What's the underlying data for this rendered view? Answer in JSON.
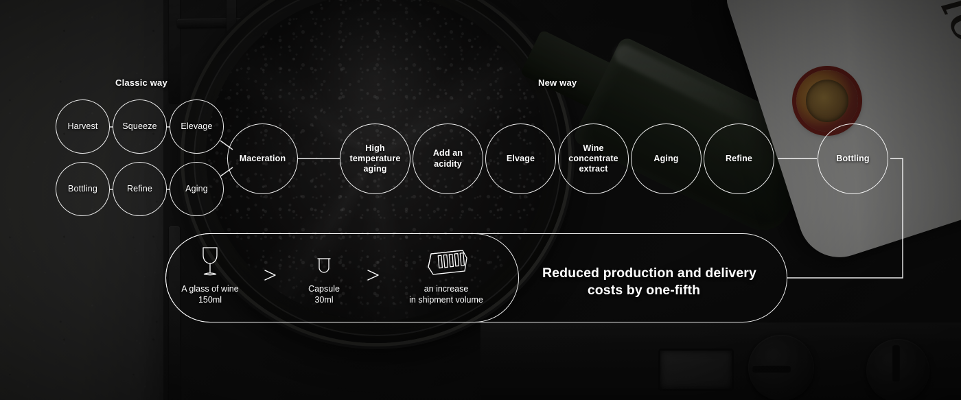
{
  "sections": {
    "classic_label": "Classic way",
    "new_label": "New way"
  },
  "classic_way": {
    "row_top": [
      {
        "label": "Harvest"
      },
      {
        "label": "Squeeze"
      },
      {
        "label": "Elevage"
      }
    ],
    "row_bottom": [
      {
        "label": "Bottling"
      },
      {
        "label": "Refine"
      },
      {
        "label": "Aging"
      }
    ]
  },
  "hub": {
    "label": "Maceration"
  },
  "new_way": [
    {
      "label": "High\ntemperature\naging"
    },
    {
      "label": "Add an\nacidity"
    },
    {
      "label": "Elvage"
    },
    {
      "label": "Wine\nconcentrate\nextract"
    },
    {
      "label": "Aging"
    },
    {
      "label": "Refine"
    },
    {
      "label": "Bottling"
    }
  ],
  "metrics_panel": {
    "items": [
      {
        "icon": "wine-glass-icon",
        "line1": "A glass of wine",
        "line2": "150ml"
      },
      {
        "icon": "capsule-icon",
        "line1": "Capsule",
        "line2": "30ml"
      },
      {
        "icon": "shipping-container-icon",
        "line1": "an increase",
        "line2": "in shipment volume"
      }
    ],
    "arrow_icon": "arrow-right-icon",
    "headline_line1": "Reduced production and delivery",
    "headline_line2": "costs by one-fifth"
  },
  "background": {
    "bottle_label_text": "Carlo Ross",
    "scene": "dark stove top with pot of wine and wine bottles"
  },
  "colors": {
    "stroke": "#ffffff",
    "text": "#ffffff",
    "backdrop": "#121212",
    "counter": "#3c3c3a",
    "seal_red": "#6d1f1a",
    "seal_gold": "#9a7a3c"
  }
}
